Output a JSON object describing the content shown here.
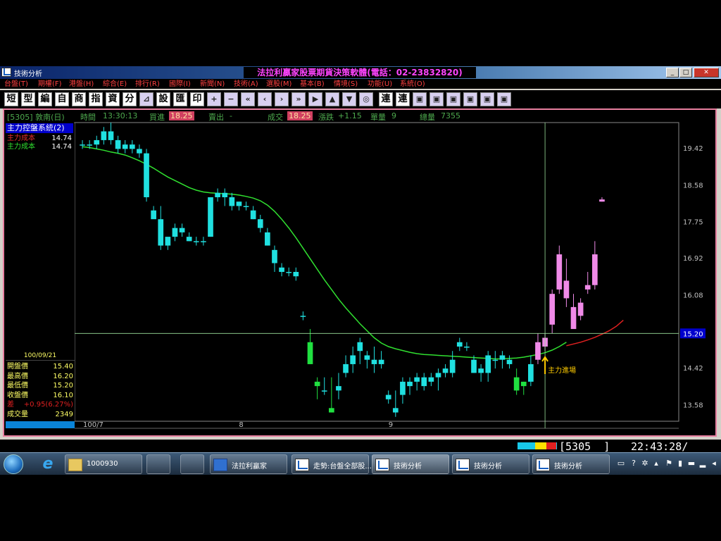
{
  "window": {
    "title": "技術分析",
    "app_title": "法拉利贏家股票期貨決策軟體(電話：02-23832820)",
    "controls": {
      "minimize": "_",
      "maximize": "□",
      "close": "✕"
    }
  },
  "menu": [
    "台盤(T)",
    "期權(F)",
    "港盤(H)",
    "綜合(E)",
    "排行(R)",
    "國際(I)",
    "新聞(N)",
    "技術(A)",
    "選股(M)",
    "基本(B)",
    "情境(S)",
    "功能(U)",
    "系統(O)"
  ],
  "toolbar": {
    "text_buttons": [
      "短",
      "型",
      "編",
      "自",
      "商",
      "指",
      "資",
      "分"
    ],
    "second_buttons": [
      "設",
      "匯",
      "印"
    ],
    "symbol_buttons": [
      "+",
      "−",
      "«",
      "‹",
      "›",
      "»",
      "▶",
      "▲",
      "▼",
      "◎"
    ],
    "tail_buttons": [
      "連",
      "連"
    ],
    "icon_names": [
      "chart-type-icon",
      "plus-icon",
      "minus-icon",
      "rewind-icon",
      "prev-icon",
      "next-icon",
      "fast-forward-icon",
      "play-icon",
      "up-icon",
      "down-icon",
      "target-icon",
      "copy-icon",
      "lock-icon",
      "paste-icon",
      "export-icon",
      "edit-icon",
      "window-icon"
    ]
  },
  "infobar": {
    "stock": "[5305] 敦南(日)",
    "time_label": "時間",
    "time": "13:30:13",
    "bid_label": "買進",
    "bid": "18.25",
    "ask_label": "賣出",
    "ask": "-",
    "deal_label": "成交",
    "deal": "18.25",
    "change_label": "漲跌",
    "change": "+1.15",
    "vol_label": "單量",
    "vol": "9",
    "total_label": "總量",
    "total": "7355"
  },
  "indicator": {
    "title": "主力控盤系統(2)",
    "rows": [
      {
        "label": "主力成本",
        "value": "14.74",
        "color": "#e83030"
      },
      {
        "label": "主力成本",
        "value": "14.74",
        "color": "#30e030"
      }
    ]
  },
  "quote": {
    "date": "100/09/21",
    "rows": [
      {
        "label": "開盤價",
        "value": "15.40"
      },
      {
        "label": "最高價",
        "value": "16.20"
      },
      {
        "label": "最低價",
        "value": "15.20"
      },
      {
        "label": "收盤價",
        "value": "16.10"
      },
      {
        "label": "差",
        "value": "+0.95(6.27%)"
      },
      {
        "label": "成交量",
        "value": "2349"
      }
    ]
  },
  "chart_data": {
    "type": "candlestick",
    "y_ticks": [
      19.42,
      18.58,
      17.75,
      16.92,
      16.08,
      15.2,
      14.42,
      13.58
    ],
    "ylim": [
      13.2,
      20.0
    ],
    "cursor_price": "15.20",
    "x_labels": [
      "100/7",
      "8",
      "9"
    ],
    "annotation": "主力進場",
    "candles": [
      [
        19.5,
        19.6,
        19.4,
        19.5
      ],
      [
        19.5,
        19.6,
        19.4,
        19.5
      ],
      [
        19.5,
        19.7,
        19.4,
        19.6
      ],
      [
        19.6,
        19.9,
        19.5,
        19.8
      ],
      [
        19.8,
        20.0,
        19.5,
        19.6
      ],
      [
        19.6,
        19.7,
        19.3,
        19.4
      ],
      [
        19.4,
        19.6,
        19.3,
        19.5
      ],
      [
        19.5,
        19.6,
        19.3,
        19.4
      ],
      [
        19.4,
        19.5,
        19.2,
        19.3
      ],
      [
        19.3,
        19.4,
        18.2,
        18.3
      ],
      [
        18.0,
        18.1,
        17.9,
        17.8
      ],
      [
        17.8,
        18.1,
        17.1,
        17.2
      ],
      [
        17.2,
        17.3,
        17.1,
        17.4
      ],
      [
        17.4,
        17.7,
        17.3,
        17.6
      ],
      [
        17.5,
        17.7,
        17.4,
        17.6
      ],
      [
        17.4,
        17.5,
        17.3,
        17.3
      ],
      [
        17.3,
        17.4,
        17.2,
        17.3
      ],
      [
        17.3,
        17.4,
        17.2,
        17.3
      ],
      [
        17.4,
        18.3,
        17.4,
        18.3
      ],
      [
        18.3,
        18.5,
        18.2,
        18.4
      ],
      [
        18.3,
        18.5,
        18.1,
        18.4
      ],
      [
        18.3,
        18.4,
        18.0,
        18.1
      ],
      [
        18.2,
        18.2,
        18.0,
        18.1
      ],
      [
        18.1,
        18.2,
        18.0,
        18.1
      ],
      [
        18.0,
        18.1,
        17.8,
        17.8
      ],
      [
        17.8,
        17.9,
        17.5,
        17.6
      ],
      [
        17.5,
        17.6,
        17.2,
        17.2
      ],
      [
        17.1,
        17.2,
        16.6,
        16.8
      ],
      [
        16.7,
        16.8,
        16.5,
        16.6
      ],
      [
        16.6,
        16.7,
        16.5,
        16.6
      ],
      [
        16.6,
        16.7,
        16.4,
        16.5
      ],
      [
        15.6,
        15.7,
        15.5,
        15.6
      ],
      [
        15.0,
        15.3,
        14.5,
        14.5
      ],
      [
        14.1,
        14.2,
        13.7,
        14.0
      ],
      [
        13.9,
        14.2,
        13.8,
        13.9
      ],
      [
        13.5,
        14.2,
        13.4,
        13.4
      ],
      [
        13.9,
        14.3,
        13.7,
        14.0
      ],
      [
        14.3,
        14.7,
        14.2,
        14.5
      ],
      [
        14.5,
        14.9,
        14.3,
        14.7
      ],
      [
        14.8,
        15.1,
        14.5,
        15.0
      ],
      [
        14.6,
        14.8,
        14.4,
        14.7
      ],
      [
        14.6,
        14.9,
        14.3,
        14.5
      ],
      [
        14.5,
        14.8,
        14.4,
        14.6
      ],
      [
        13.7,
        13.9,
        13.6,
        13.8
      ],
      [
        13.5,
        13.9,
        13.3,
        13.4
      ],
      [
        13.8,
        14.2,
        13.6,
        14.1
      ],
      [
        14.0,
        14.2,
        13.8,
        14.1
      ],
      [
        14.1,
        14.3,
        13.9,
        14.2
      ],
      [
        14.0,
        14.3,
        13.9,
        14.2
      ],
      [
        14.2,
        14.3,
        14.0,
        14.1
      ],
      [
        14.2,
        14.4,
        13.9,
        14.3
      ],
      [
        14.4,
        14.5,
        14.2,
        14.3
      ],
      [
        14.3,
        14.8,
        14.2,
        14.6
      ],
      [
        14.9,
        15.1,
        14.8,
        15.0
      ],
      [
        14.9,
        15.0,
        14.8,
        14.9
      ],
      [
        14.6,
        14.7,
        14.3,
        14.3
      ],
      [
        14.4,
        14.5,
        14.1,
        14.3
      ],
      [
        14.3,
        14.8,
        14.1,
        14.7
      ],
      [
        14.6,
        14.8,
        14.4,
        14.6
      ],
      [
        14.6,
        14.8,
        14.4,
        14.7
      ],
      [
        14.5,
        14.7,
        14.4,
        14.6
      ],
      [
        14.2,
        14.4,
        13.8,
        13.9
      ],
      [
        14.0,
        14.1,
        13.8,
        14.1
      ],
      [
        14.1,
        14.7,
        14.0,
        14.5
      ],
      [
        14.6,
        15.2,
        14.5,
        15.0
      ],
      [
        14.9,
        15.2,
        14.8,
        15.1
      ],
      [
        15.4,
        16.2,
        15.2,
        16.1
      ],
      [
        16.2,
        17.2,
        16.1,
        17.0
      ],
      [
        16.4,
        16.9,
        15.8,
        16.0
      ],
      [
        15.8,
        16.1,
        15.4,
        15.3
      ],
      [
        15.6,
        16.0,
        15.5,
        15.9
      ],
      [
        16.2,
        16.6,
        16.1,
        16.3
      ],
      [
        16.3,
        17.3,
        16.2,
        17.0
      ],
      [
        18.2,
        18.3,
        18.2,
        18.25
      ]
    ],
    "ma_green": [
      19.45,
      19.43,
      19.4,
      19.37,
      19.33,
      19.3,
      19.26,
      19.2,
      19.13,
      19.05,
      18.96,
      18.86,
      18.76,
      18.68,
      18.6,
      18.52,
      18.46,
      18.42,
      18.4,
      18.39,
      18.38,
      18.37,
      18.35,
      18.32,
      18.28,
      18.22,
      18.12,
      17.98,
      17.8,
      17.6,
      17.38,
      17.14,
      16.9,
      16.66,
      16.42,
      16.2,
      15.98,
      15.78,
      15.6,
      15.42,
      15.26,
      15.1,
      14.98,
      14.9,
      14.85,
      14.81,
      14.77,
      14.74,
      14.72,
      14.71,
      14.7,
      14.69,
      14.68,
      14.67,
      14.66,
      14.65,
      14.64,
      14.63,
      14.62,
      14.62,
      14.63,
      14.64,
      14.66,
      14.69,
      14.72,
      14.76,
      14.82,
      14.9,
      15.0
    ],
    "ma_red": [
      14.92,
      14.96,
      15.0,
      15.05,
      15.11,
      15.18,
      15.26,
      15.36,
      15.5
    ]
  },
  "status": {
    "code": "[5305_  ]",
    "time": "22:43:28/"
  },
  "taskbar": {
    "items": [
      {
        "label": "1000930",
        "kind": "folder"
      },
      {
        "label": "法拉利贏家",
        "kind": "app"
      },
      {
        "label": "走勢:台盤全部股...",
        "kind": "chart"
      },
      {
        "label": "技術分析",
        "kind": "chart"
      },
      {
        "label": "技術分析",
        "kind": "chart"
      },
      {
        "label": "技術分析",
        "kind": "chart"
      }
    ]
  },
  "colors": {
    "up": "#f08ae8",
    "down": "#20e0e0",
    "up_alt": "#ffffff",
    "ma_green": "#30e030",
    "ma_red": "#e02020",
    "axis_text": "#c0c0c0",
    "cursor_label_bg": "#0000cc"
  }
}
